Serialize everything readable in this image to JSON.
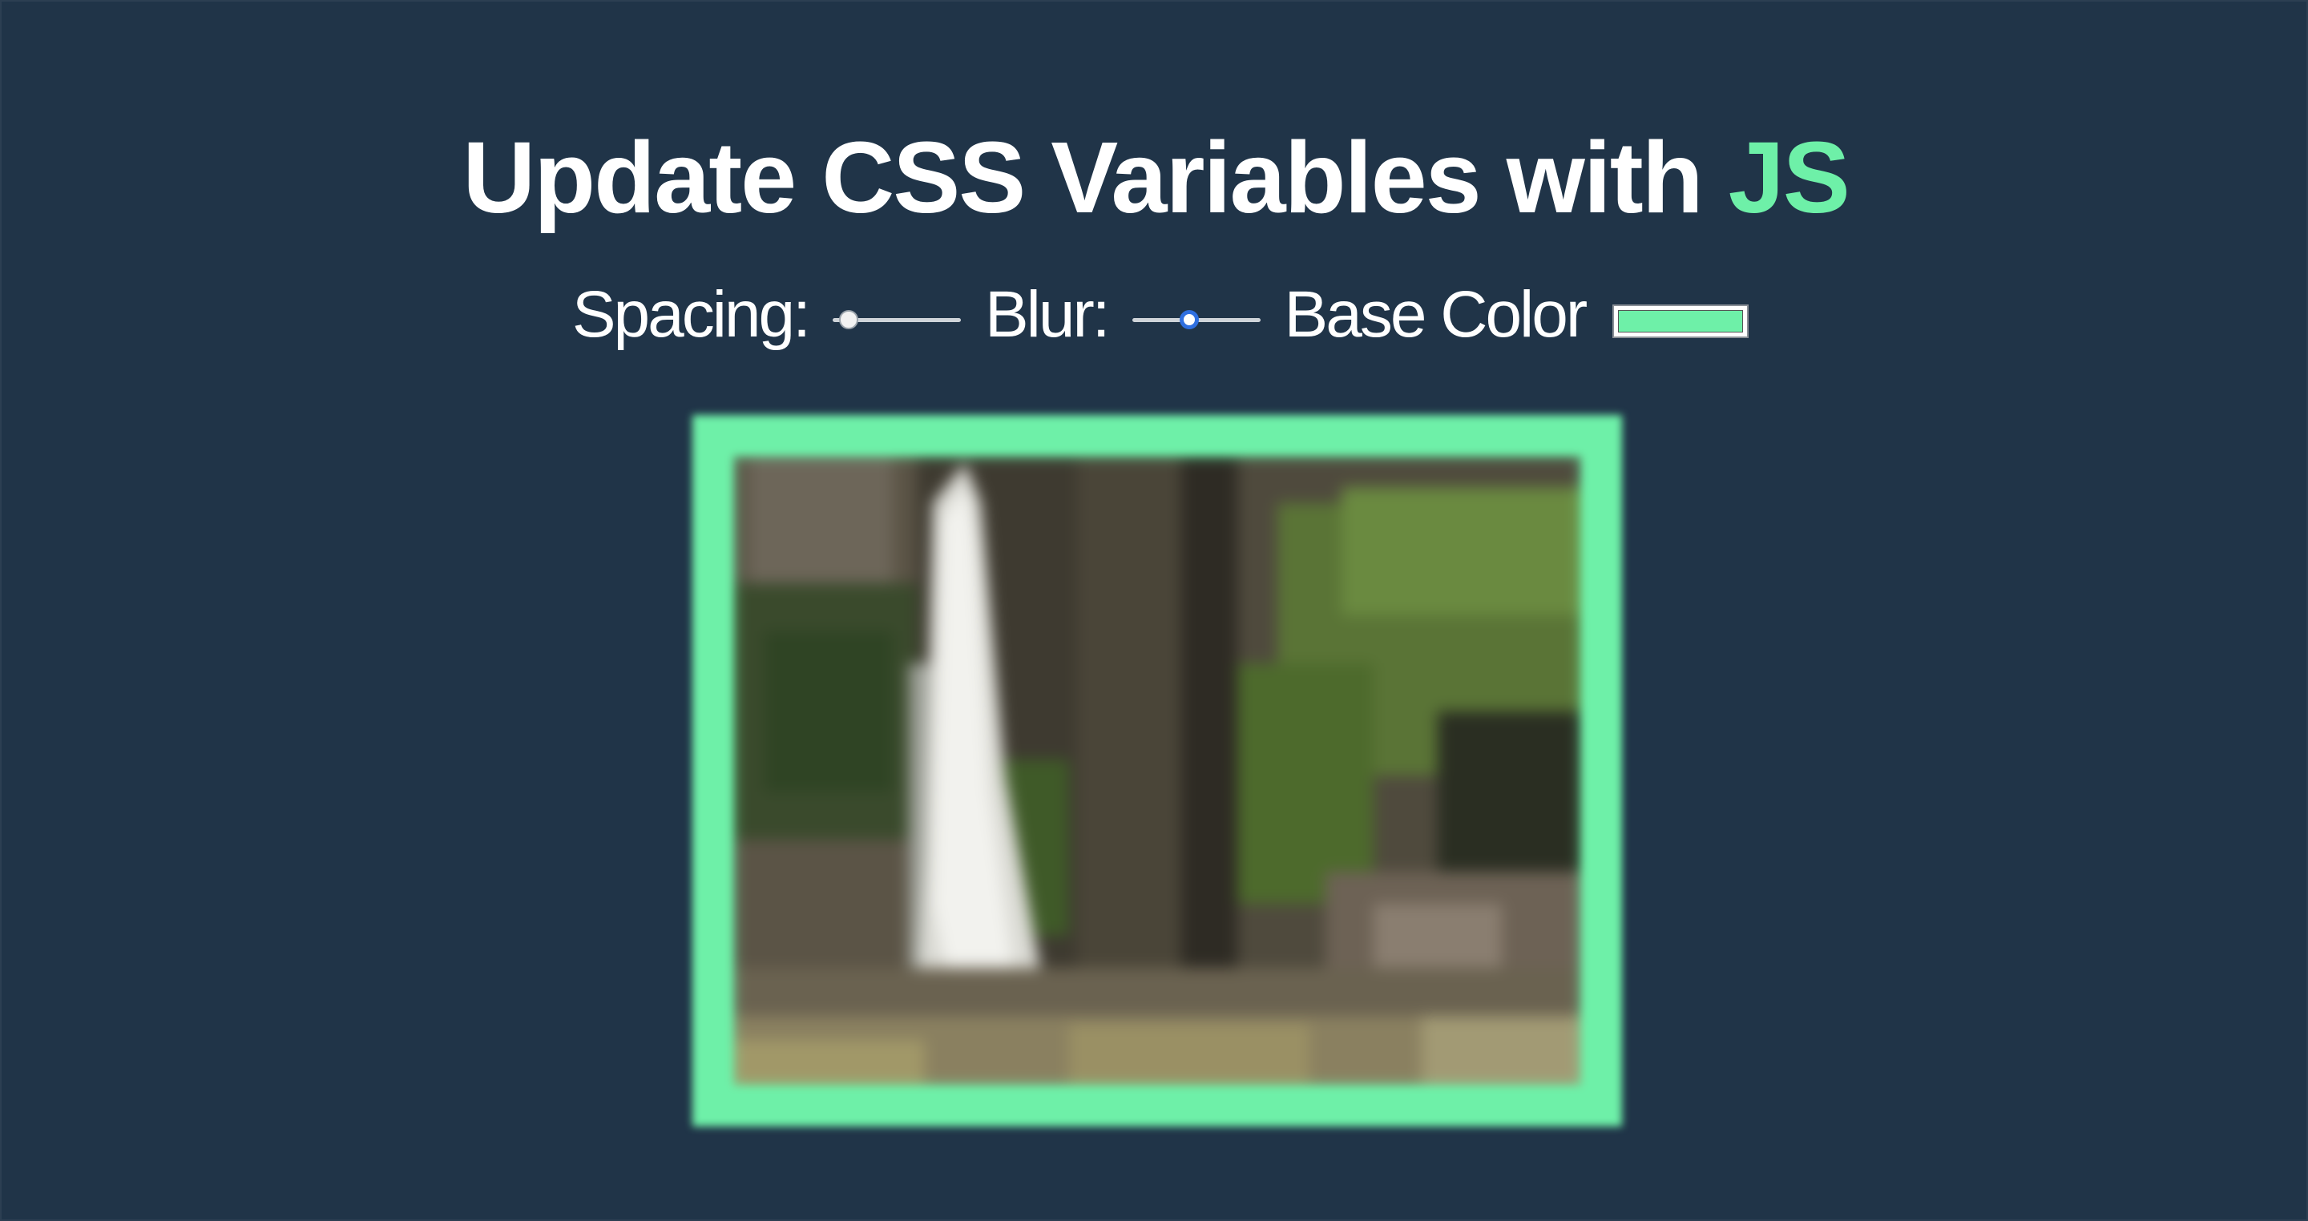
{
  "title": {
    "prefix": "Update CSS Variables with ",
    "highlight": "JS"
  },
  "controls": {
    "spacing_label": "Spacing:",
    "spacing_value": 10,
    "spacing_min": 10,
    "spacing_max": 200,
    "blur_label": "Blur:",
    "blur_value": 10,
    "blur_min": 0,
    "blur_max": 25,
    "base_color_label": "Base Color",
    "base_color_value": "#6ef0a8"
  },
  "colors": {
    "background": "#203448",
    "accent": "#6ef0a8",
    "text": "#ffffff"
  },
  "image": {
    "subject": "waterfall photo"
  }
}
